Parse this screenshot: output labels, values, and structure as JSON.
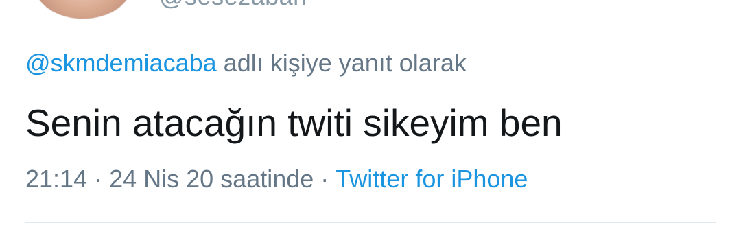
{
  "tweet": {
    "author_handle": "@sesezabah",
    "reply_to": {
      "mention": "@skmdemiacaba",
      "suffix": "adlı kişiye yanıt olarak"
    },
    "text": "Senin atacağın twiti sikeyim ben",
    "time": "21:14",
    "date": "24 Nis 20 saatinde",
    "separator": "·",
    "source": "Twitter for iPhone"
  },
  "colors": {
    "link": "#1b95e0",
    "secondary_text": "#657786",
    "primary_text": "#14171a",
    "divider": "#e1e8ed"
  }
}
